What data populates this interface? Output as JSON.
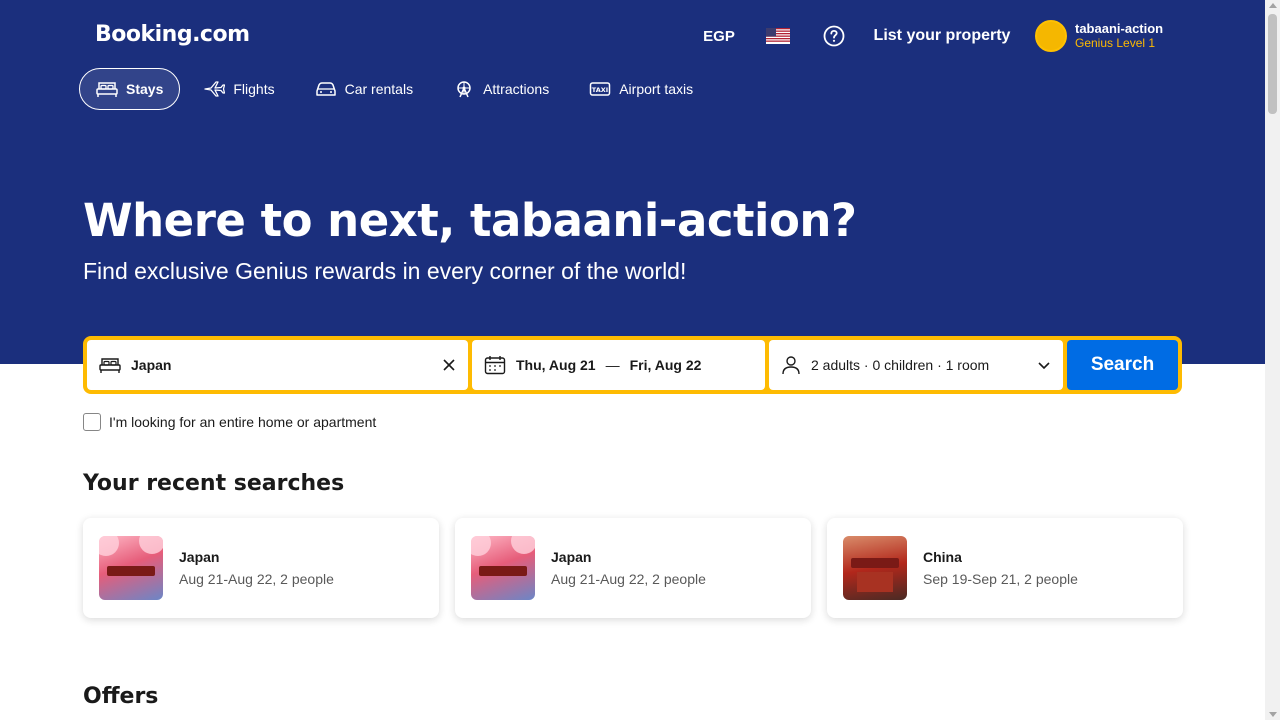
{
  "header": {
    "logo": "Booking.com",
    "currency": "EGP",
    "list_property": "List your property",
    "account": {
      "name": "tabaani-action",
      "level": "Genius Level 1"
    }
  },
  "tabs": [
    {
      "label": "Stays",
      "icon": "bed-icon",
      "active": true
    },
    {
      "label": "Flights",
      "icon": "plane-icon",
      "active": false
    },
    {
      "label": "Car rentals",
      "icon": "car-icon",
      "active": false
    },
    {
      "label": "Attractions",
      "icon": "attractions-icon",
      "active": false
    },
    {
      "label": "Airport taxis",
      "icon": "taxi-icon",
      "active": false
    }
  ],
  "hero": {
    "title": "Where to next, tabaani-action?",
    "subtitle": "Find exclusive Genius rewards in every corner of the world!"
  },
  "search": {
    "destination": "Japan",
    "checkin": "Thu, Aug 21",
    "separator": "—",
    "checkout": "Fri, Aug 22",
    "guests": "2 adults · 0 children · 1 room",
    "button": "Search",
    "checkbox_label": "I'm looking for an entire home or apartment"
  },
  "recent": {
    "title": "Your recent searches",
    "items": [
      {
        "city": "Japan",
        "meta": "Aug 21-Aug 22, 2 people"
      },
      {
        "city": "Japan",
        "meta": "Aug 21-Aug 22, 2 people"
      },
      {
        "city": "China",
        "meta": "Sep 19-Sep 21, 2 people"
      }
    ]
  },
  "offers_title": "Offers",
  "colors": {
    "brand_blue": "#1b2f7d",
    "search_yellow": "#febb02",
    "action_blue": "#006ce4",
    "genius_gold": "#febb02"
  }
}
